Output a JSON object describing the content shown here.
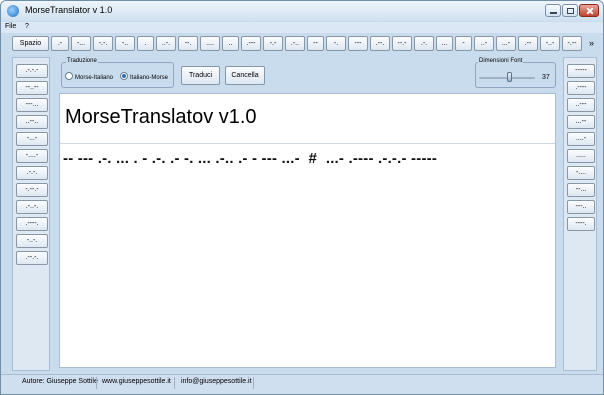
{
  "window": {
    "title": "MorseTranslator v 1.0"
  },
  "menu": {
    "items": [
      "File",
      "?"
    ]
  },
  "top_buttons": [
    "Spazio",
    ".-",
    "-...",
    "-.-.",
    "-..",
    ".",
    "..-.",
    "--.",
    "....",
    "..",
    ".---",
    "-.-",
    ".-..",
    "--",
    "-.",
    "---",
    ".--.",
    "--.-",
    ".-.",
    "...",
    "-",
    "..-",
    "...-",
    ".--",
    "-..-",
    "-.--"
  ],
  "more_glyph": "»",
  "left_buttons": [
    ".-.-.-",
    "--..--",
    "---...",
    "..--..",
    "-...-",
    "-....-",
    ".-.-.",
    "-.--.-",
    ".-..-.",
    ".----.",
    "-..-.",
    ".--.-."
  ],
  "right_buttons": [
    "-----",
    ".----",
    "..---",
    "...--",
    "....-",
    ".....",
    "-....",
    "--...",
    "---..",
    "----."
  ],
  "translation": {
    "group_label": "Traduzione",
    "options": [
      "Morse-Italiano",
      "Italiano-Morse"
    ],
    "selected": "Italiano-Morse"
  },
  "actions": {
    "translate": "Traduci",
    "clear": "Cancella"
  },
  "font_size": {
    "label": "Dimensioni Font",
    "value": 37,
    "slider_fraction": 0.52
  },
  "document": {
    "title_text": "MorseTranslatov v1.0",
    "morse_text": "-- --- .-. ... . - .-. .- -. ... .-.. .- - --- ...-  #  ...- .---- .-.-.- -----"
  },
  "status": {
    "author": "Autore: Giuseppe Sottile",
    "website": "www.giuseppesottile.it",
    "email": "info@giuseppesottile.it"
  },
  "colors": {
    "window_bg": "#c9dcee",
    "titlebar": "#cfe0f0",
    "close_button": "#c2412f",
    "document_bg": "#ffffff"
  }
}
